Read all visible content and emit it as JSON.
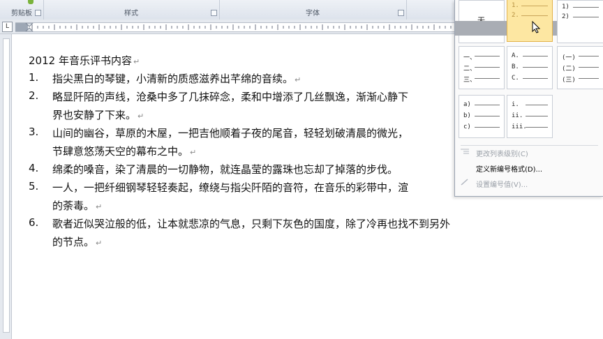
{
  "ribbon": {
    "groups": [
      {
        "label": "剪贴板"
      },
      {
        "label": "样式"
      },
      {
        "label": "字体"
      }
    ]
  },
  "ruler": {
    "tab_stop_glyph": "L"
  },
  "document": {
    "title": "2012 年音乐评书内容",
    "items": [
      {
        "number": "1.",
        "lines": [
          "指尖黑白的琴键，小清新的质感滋养出芊绵的音续。"
        ]
      },
      {
        "number": "2.",
        "lines": [
          "略显阡陌的声线，沧桑中多了几抹碎念，柔和中增添了几丝飘逸，渐渐心静下",
          "界也安静了下来。"
        ]
      },
      {
        "number": "3.",
        "lines": [
          "山间的幽谷，草原的木屋，一把吉他顺着子夜的尾音，轻轻划破清晨的微光，",
          "节肆意悠荡天空的幕布之中。"
        ]
      },
      {
        "number": "4.",
        "lines": [
          "绵柔的嗓音，染了清晨的一切静物，就连晶莹的露珠也忘却了掉落的步伐。"
        ]
      },
      {
        "number": "5.",
        "lines": [
          "一人，一把纤细钢琴轻轻奏起，缭绕与指尖阡陌的音符，在音乐的彩带中，渲",
          "的荼毒。"
        ]
      },
      {
        "number": "6.",
        "lines": [
          "歌者近似哭泣般的低，让本就悲凉的气息，只剩下灰色的国度，除了冷再也找不到另外",
          "的节点。"
        ]
      }
    ],
    "paragraph_mark": "↵"
  },
  "numbering_gallery": {
    "cells": [
      {
        "rows": [
          "无"
        ]
      },
      {
        "rows": [
          "1.",
          "2.",
          "3."
        ]
      },
      {
        "rows": [
          "1)",
          "2)",
          "3)"
        ]
      },
      {
        "rows": [
          "一、",
          "二、",
          "三、"
        ]
      },
      {
        "rows": [
          "A.",
          "B.",
          "C."
        ]
      },
      {
        "rows": [
          "(一)",
          "(二)",
          "(三)"
        ]
      },
      {
        "rows": [
          "a)",
          "b)",
          "c)"
        ]
      },
      {
        "rows": [
          "i.",
          "ii.",
          "iii."
        ]
      }
    ],
    "menu": [
      {
        "label": "更改列表级别(C)",
        "enabled": false
      },
      {
        "label": "定义新编号格式(D)...",
        "enabled": true
      },
      {
        "label": "设置编号值(V)...",
        "enabled": false
      }
    ]
  },
  "colors": {
    "selected_cell": "#fde7a2",
    "selected_border": "#e3b34b"
  }
}
